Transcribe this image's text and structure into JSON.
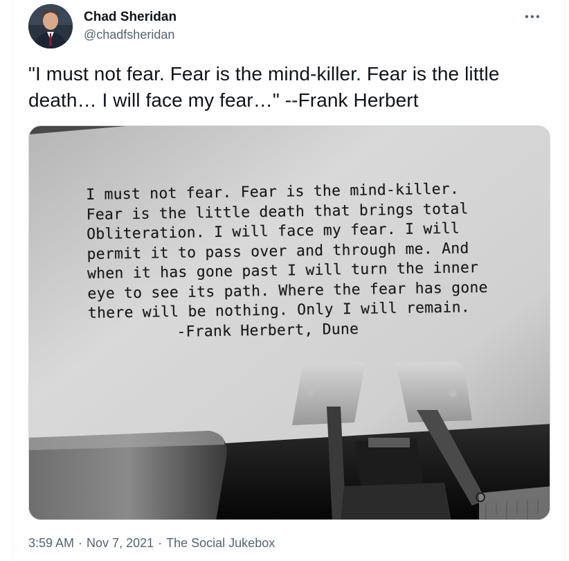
{
  "user": {
    "display_name": "Chad Sheridan",
    "handle": "@chadfsheridan"
  },
  "tweet": {
    "text": "\"I must not fear. Fear is the mind-killer. Fear is the little death… I will face my fear…\" --Frank Herbert"
  },
  "media": {
    "lines": [
      "I must not fear. Fear is the mind-killer.",
      "Fear is the little death that brings total",
      "Obliteration. I will face my fear. I will",
      "permit it to pass over and through me. And",
      "when it has gone past I will turn the inner",
      "eye to see its path. Where the fear has gone",
      "there will be nothing. Only I will remain."
    ],
    "attribution": "-Frank Herbert, Dune"
  },
  "meta": {
    "time": "3:59 AM",
    "date": "Nov 7, 2021",
    "source": "The Social Jukebox",
    "separator": "·"
  },
  "icons": {
    "more": "more-dots-icon"
  },
  "colors": {
    "text_primary": "#0f1419",
    "text_secondary": "#536471",
    "border": "#cfd9de"
  }
}
